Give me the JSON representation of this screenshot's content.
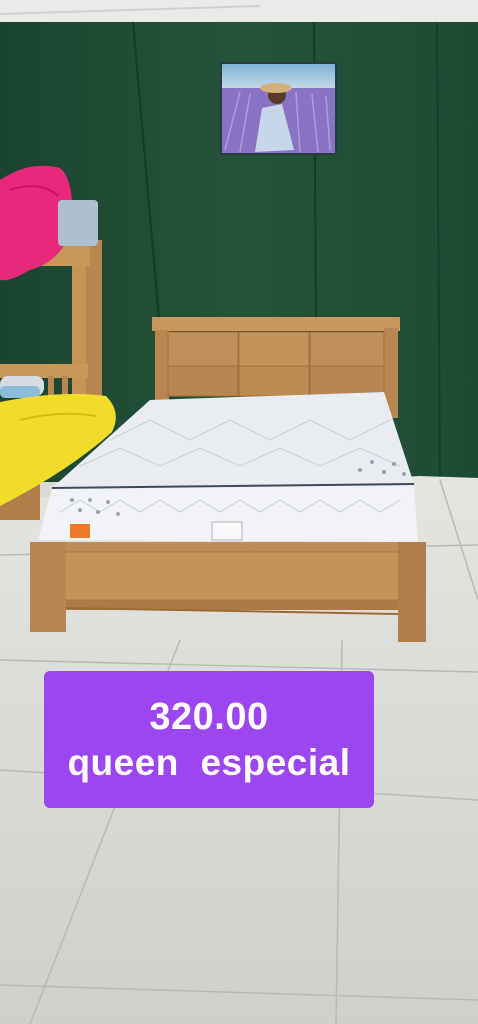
{
  "listing": {
    "price": "320.00",
    "product_name": "queen  especial"
  },
  "colors": {
    "wall": "#1f4a33",
    "floor": "#dcddd8",
    "wood": "#b8864e",
    "mattress": "#e8ebef",
    "label_bg": "#9b46f0",
    "label_text": "#ffffff"
  }
}
